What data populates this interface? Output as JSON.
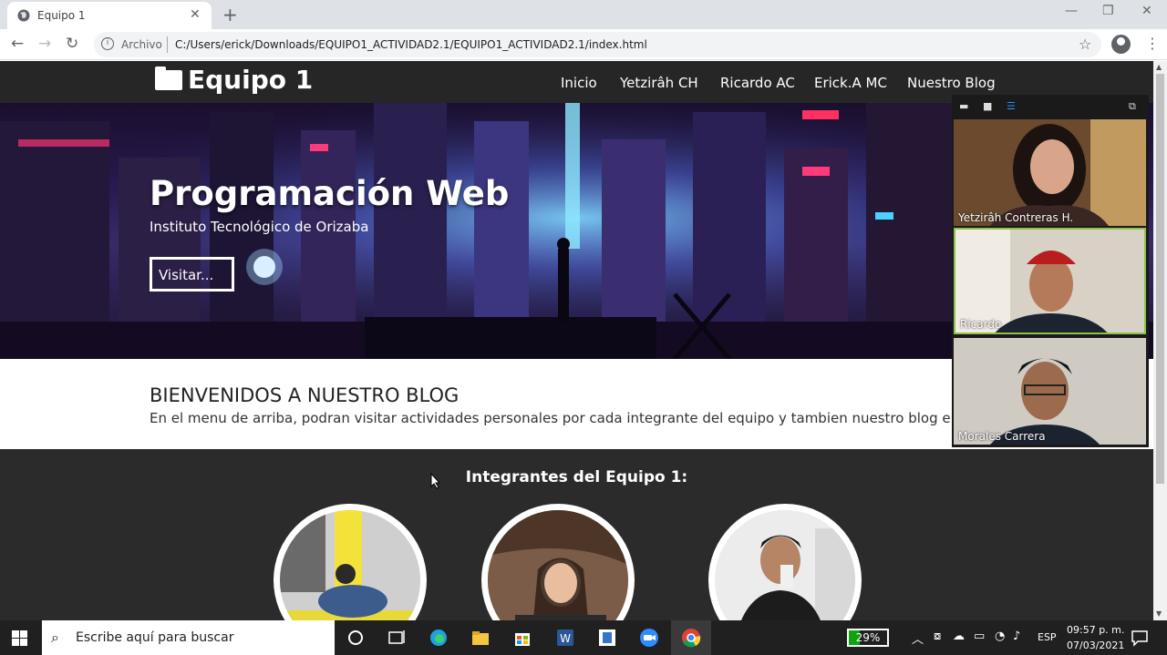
{
  "browser": {
    "tab_title": "Equipo 1",
    "tab_close": "✕",
    "new_tab": "+",
    "address_label": "Archivo",
    "url": "C:/Users/erick/Downloads/EQUIPO1_ACTIVIDAD2.1/EQUIPO1_ACTIVIDAD2.1/index.html"
  },
  "site": {
    "brand": "Equipo 1",
    "nav": [
      "Inicio",
      "Yetzirâh CH",
      "Ricardo AC",
      "Erick.A MC",
      "Nuestro Blog"
    ],
    "hero": {
      "title": "Programación Web",
      "subtitle": "Instituto Tecnológico de Orizaba",
      "button": "Visitar..."
    },
    "welcome": {
      "title": "BIENVENIDOS A NUESTRO BLOG",
      "text": "En el menu de arriba, podran visitar actividades personales por cada integrante del equipo y tambien nuestro blog en conjunto"
    },
    "members_title": "Integrantes del Equipo 1:"
  },
  "call": {
    "participants": [
      "Yetzirâh Contreras H.",
      "Ricardo",
      "Morales Carrera"
    ]
  },
  "taskbar": {
    "search_placeholder": "Escribe aquí para buscar",
    "battery": "29%",
    "language": "ESP",
    "time": "09:57 p. m.",
    "date": "07/03/2021"
  },
  "colors": {
    "page_bg": "#2b2b2b",
    "navbar_bg": "#262626",
    "active_speaker_border": "#8bc34a"
  }
}
